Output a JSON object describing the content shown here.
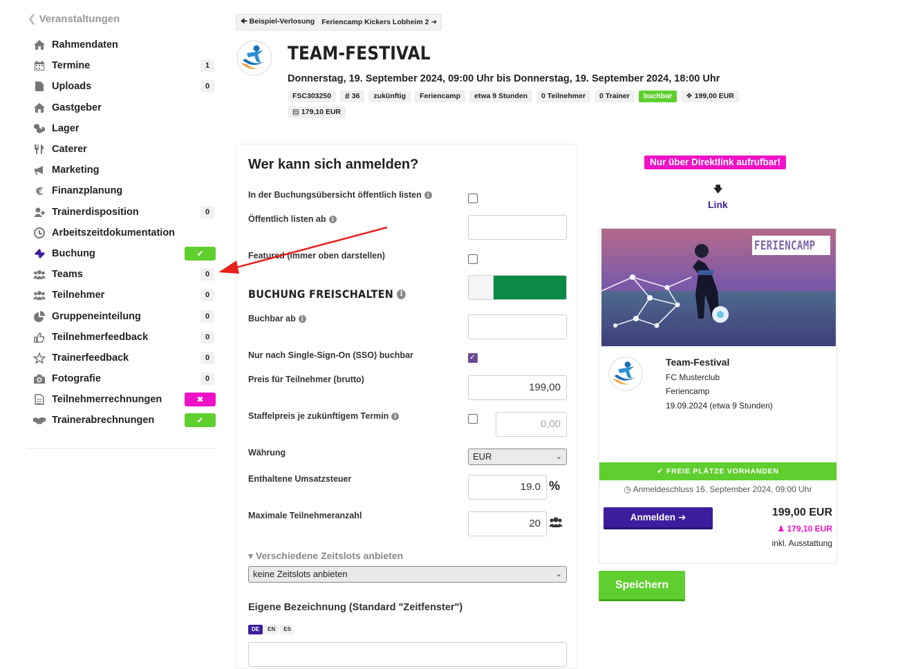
{
  "sidebar": {
    "back_label": "Veranstaltungen",
    "items": [
      {
        "label": "Rahmendaten",
        "icon": "home-icon"
      },
      {
        "label": "Termine",
        "icon": "calendar-icon",
        "count": "1"
      },
      {
        "label": "Uploads",
        "icon": "file-icon",
        "count": "0"
      },
      {
        "label": "Gastgeber",
        "icon": "home-icon"
      },
      {
        "label": "Lager",
        "icon": "cubes-icon"
      },
      {
        "label": "Caterer",
        "icon": "cutlery-icon"
      },
      {
        "label": "Marketing",
        "icon": "bullhorn-icon"
      },
      {
        "label": "Finanzplanung",
        "icon": "euro-icon"
      },
      {
        "label": "Trainerdisposition",
        "icon": "user-plus-icon",
        "count": "0"
      },
      {
        "label": "Arbeitszeitdokumentation",
        "icon": "clock-icon"
      },
      {
        "label": "Buchung",
        "icon": "ticket-icon",
        "status": "ok"
      },
      {
        "label": "Teams",
        "icon": "users-icon",
        "count": "0"
      },
      {
        "label": "Teilnehmer",
        "icon": "users-icon",
        "count": "0"
      },
      {
        "label": "Gruppeneinteilung",
        "icon": "pie-chart-icon",
        "count": "0"
      },
      {
        "label": "Teilnehmerfeedback",
        "icon": "thumbs-up-icon",
        "count": "0"
      },
      {
        "label": "Trainerfeedback",
        "icon": "star-icon",
        "count": "0"
      },
      {
        "label": "Fotografie",
        "icon": "camera-icon",
        "count": "0"
      },
      {
        "label": "Teilnehmerrechnungen",
        "icon": "document-icon",
        "status": "error"
      },
      {
        "label": "Trainerabrechnungen",
        "icon": "handshake-icon",
        "status": "ok"
      }
    ]
  },
  "breadcrumb": {
    "prev": "Beispiel-Verlosung",
    "next": "Feriencamp Kickers Lobheim 2"
  },
  "event": {
    "title": "TEAM-FESTIVAL",
    "dates": "Donnerstag, 19. September 2024, 09:00 Uhr bis Donnerstag, 19. September 2024, 18:00 Uhr",
    "tags": [
      "FSC303250",
      "36",
      "zukünftig",
      "Feriencamp",
      "etwa 9 Stunden",
      "0 Teilnehmer",
      "0 Trainer",
      "buchbar",
      "199,00 EUR",
      "179,10 EUR"
    ]
  },
  "form": {
    "heading": "Wer kann sich anmelden?",
    "public_list_label": "In der Buchungsübersicht öffentlich listen",
    "public_from_label": "Öffentlich listen ab",
    "featured_label": "Featured (immer oben darstellen)",
    "unlock_heading": "BUCHUNG FREISCHALTEN",
    "bookable_from_label": "Buchbar ab",
    "sso_label": "Nur nach Single-Sign-On (SSO) buchbar",
    "price_label": "Preis für Teilnehmer (brutto)",
    "price_value": "199,00",
    "staffel_label": "Staffelpreis je zukünftigem Termin",
    "staffel_placeholder": "0,00",
    "currency_label": "Währung",
    "currency_value": "EUR",
    "vat_label": "Enthaltene Umsatzsteuer",
    "vat_value": "19.0",
    "vat_unit": "%",
    "max_label": "Maximale Teilnehmeranzahl",
    "max_value": "20",
    "slots_label": "Verschiedene Zeitslots anbieten",
    "slots_value": "keine Zeitslots anbieten",
    "custom_label": "Eigene Bezeichnung (Standard \"Zeitfenster\")",
    "langs": [
      "DE",
      "EN",
      "ES"
    ]
  },
  "preview": {
    "direct_badge": "Nur über Direktlink aufrufbar!",
    "link_label": "Link",
    "banner": "FERIENCAMP",
    "title": "Team-Festival",
    "club": "FC Musterclub",
    "category": "Feriencamp",
    "date": "19.09.2024 (etwa 9 Stunden)",
    "free_label": "FREIE PLÄTZE VORHANDEN",
    "deadline": "Anmeldeschluss 16. September 2024, 09:00 Uhr",
    "register_label": "Anmelden",
    "price": "199,00 EUR",
    "price_discount": "179,10 EUR",
    "incl": "inkl. Ausstattung"
  },
  "save_label": "Speichern",
  "colors": {
    "accent": "#3d1d9e",
    "success": "#5ecf2e",
    "magenta": "#f012c6",
    "toggle_on": "#0a8a45",
    "annotation": "#e8201a"
  }
}
